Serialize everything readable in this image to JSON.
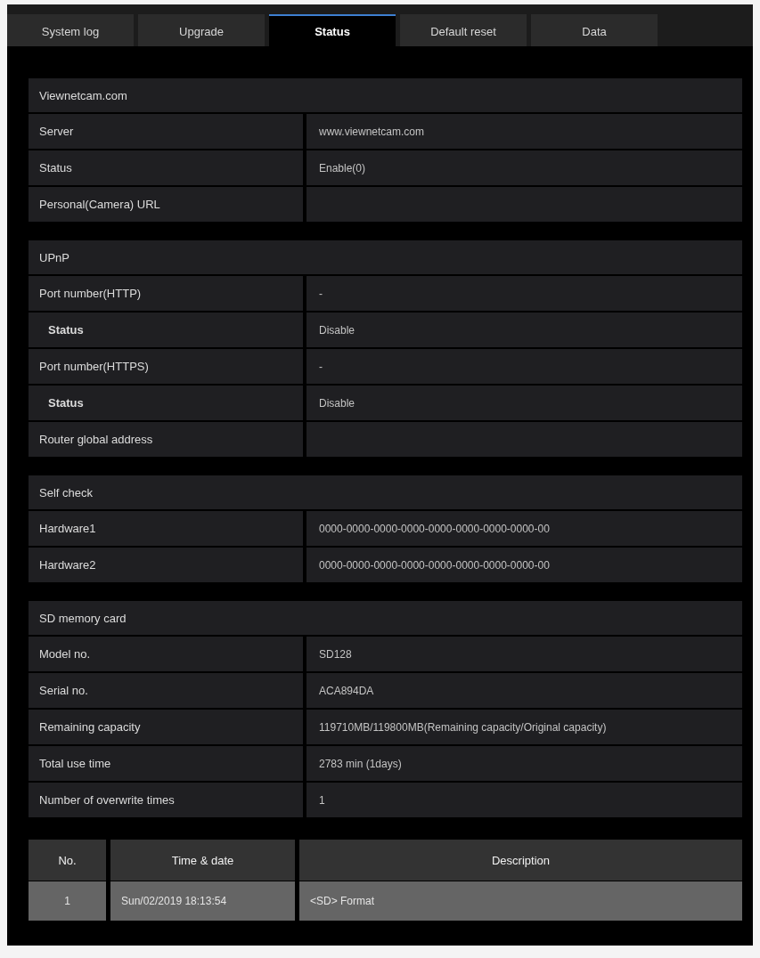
{
  "tabs": [
    {
      "label": "System log",
      "selected": false
    },
    {
      "label": "Upgrade",
      "selected": false
    },
    {
      "label": "Status",
      "selected": true
    },
    {
      "label": "Default reset",
      "selected": false
    },
    {
      "label": "Data",
      "selected": false
    }
  ],
  "sections": [
    {
      "title": "Viewnetcam.com",
      "rows": [
        {
          "label": "Server",
          "value": "www.viewnetcam.com"
        },
        {
          "label": "Status",
          "value": "Enable(0)"
        },
        {
          "label": "Personal(Camera) URL"
        }
      ]
    },
    {
      "title": "UPnP",
      "rows": [
        {
          "label": "Port number(HTTP)",
          "value": "-",
          "children": [
            {
              "label": "Status",
              "value": "Disable"
            }
          ]
        },
        {
          "label": "Port number(HTTPS)",
          "value": "-",
          "children": [
            {
              "label": "Status",
              "value": "Disable"
            }
          ]
        },
        {
          "label": "Router global address"
        }
      ]
    },
    {
      "title": "Self check",
      "rows": [
        {
          "label": "Hardware1",
          "value": "0000-0000-0000-0000-0000-0000-0000-0000-00"
        },
        {
          "label": "Hardware2",
          "value": "0000-0000-0000-0000-0000-0000-0000-0000-00"
        }
      ]
    },
    {
      "title": "SD memory card",
      "rows": [
        {
          "label": "Model no.",
          "value": "SD128"
        },
        {
          "label": "Serial no.",
          "value": "ACA894DA"
        },
        {
          "label": "Remaining capacity",
          "value": "119710MB/119800MB(Remaining capacity/Original capacity)"
        },
        {
          "label": "Total use time",
          "value": "2783 min (1days)"
        },
        {
          "label": "Number of overwrite times",
          "value": "1"
        }
      ]
    }
  ],
  "log_table": {
    "columns": [
      "No.",
      "Time & date",
      "Description"
    ],
    "rows": [
      [
        "1",
        "Sun/02/2019 18:13:54",
        "<SD> Format"
      ]
    ]
  }
}
